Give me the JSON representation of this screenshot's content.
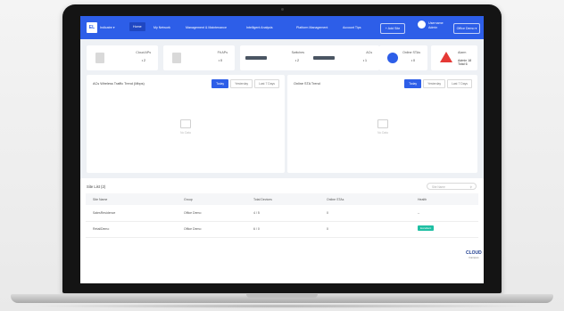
{
  "nav": {
    "logo_text": "EL",
    "org": "Indicatre ▾",
    "items": [
      "Home",
      "My Network",
      "Management & Maintenance",
      "Intelligent Analysis",
      "Platform Management",
      "Account Tips"
    ],
    "active_index": 0,
    "add_site": "+ Add Site",
    "user": {
      "name": "Username",
      "role": "Admin"
    },
    "office_select": "Office Demo ▾"
  },
  "stats": [
    {
      "title": "Cloud APs",
      "value": "• 2",
      "icon": "access-point-icon"
    },
    {
      "title": "Fit APs",
      "value": "• 0",
      "icon": "fit-ap-icon"
    },
    {
      "title": "Switches",
      "value": "• 2",
      "icon": "switch-icon"
    },
    {
      "title": "ACs",
      "value": "• 1",
      "icon": "ac-icon"
    },
    {
      "title": "Online STAs",
      "value": "• 0",
      "icon": "station-icon"
    },
    {
      "title": "Alarm",
      "value": "Admin  18  Total  6",
      "icon": "alarm-icon"
    }
  ],
  "panels": {
    "traffic": {
      "title": "ACs Wireless Traffic Trend (Mbps)",
      "tabs": [
        "Today",
        "Yesterday",
        "Last 7 Days"
      ],
      "empty": "No Data"
    },
    "sta": {
      "title": "Online STA Trend",
      "tabs": [
        "Today",
        "Yesterday",
        "Last 7 Days"
      ],
      "empty": "No Data"
    }
  },
  "site_list": {
    "title": "Site List  (2)",
    "search_placeholder": "Site Name",
    "columns": [
      "Site Name",
      "Group",
      "Total Devices",
      "Online STAs",
      "Health"
    ],
    "rows": [
      [
        "SalesResidence",
        "Office Demo",
        "4 / 5",
        "0",
        "--"
      ],
      [
        "RetailDemo",
        "Office Demo",
        "6 / 0",
        "0",
        "Excellent"
      ]
    ]
  },
  "brand": {
    "line1": "CLOUD",
    "line2": "Campus"
  },
  "colors": {
    "accent": "#2d5ee8",
    "alarm": "#e53935",
    "health_ok": "#1fbfa3"
  }
}
